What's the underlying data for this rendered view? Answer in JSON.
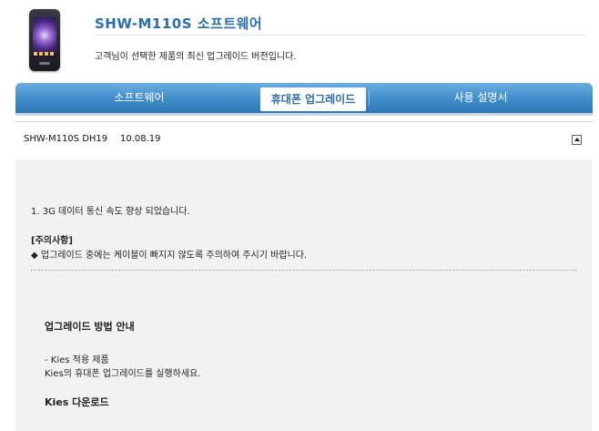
{
  "header": {
    "product_title": "SHW-M110S 소프트웨어",
    "subtitle": "고객님이 선택한 제품의 최신 업그레이드 버전입니다."
  },
  "tabs": [
    {
      "label": "소프트웨어",
      "active": false
    },
    {
      "label": "휴대폰 업그레이드",
      "active": true
    },
    {
      "label": "사용 설명서",
      "active": false
    }
  ],
  "release": {
    "model": "SHW-M110S DH19",
    "date": "10.08.19"
  },
  "details": {
    "note": "1. 3G 데이터 통신 속도 향상 되었습니다.",
    "caution_heading": "[주의사항]",
    "caution": "◆ 업그레이드 중에는 케이블이 빠지지 않도록 주의하여 주시기 바랍니다."
  },
  "guide": {
    "heading": "업그레이드 방법 안내",
    "kies_line1": "- Kies 적용 제품",
    "kies_line2": "Kies의 휴대폰 업그레이드를 실행하세요.",
    "kies_download": "Kies 다운로드"
  },
  "colors": {
    "tab_gradient_top": "#6aaee0",
    "tab_gradient_bottom": "#2f78b6",
    "title_blue": "#2a6fa8",
    "content_bg": "#f2f2f2"
  }
}
